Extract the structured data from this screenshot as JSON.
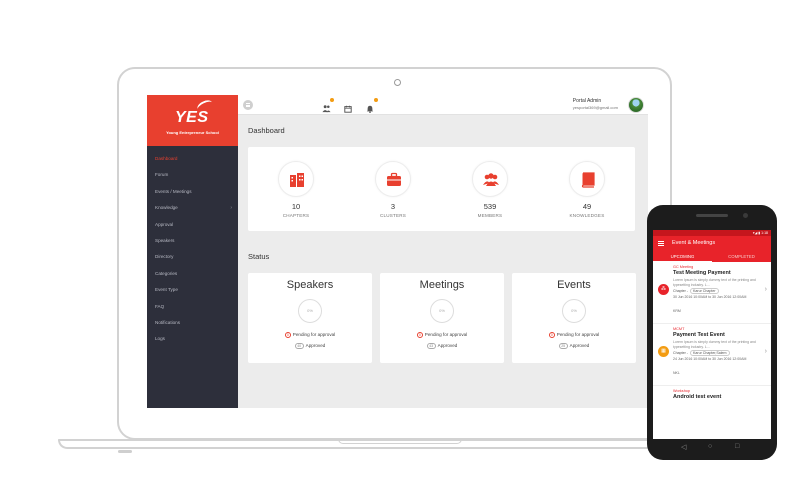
{
  "sidebar": {
    "logo": {
      "text": "YES",
      "tagline": "Young Entrepreneur School"
    },
    "items": [
      {
        "label": "Dashboard",
        "active": true
      },
      {
        "label": "Forum"
      },
      {
        "label": "Events / Meetings"
      },
      {
        "label": "Knowledge",
        "has_submenu": true,
        "caret": "›"
      },
      {
        "label": "Approval"
      },
      {
        "label": "Speakers"
      },
      {
        "label": "Directory"
      },
      {
        "label": "Categories"
      },
      {
        "label": "Event Type"
      },
      {
        "label": "FAQ"
      },
      {
        "label": "Notifications"
      },
      {
        "label": "Logs"
      }
    ]
  },
  "topbar": {
    "icons": [
      "users-icon",
      "calendar-icon",
      "bell-icon"
    ],
    "user": {
      "name": "Portal Admin",
      "email": "yesportal369@gmail.com"
    }
  },
  "dashboard": {
    "title": "Dashboard",
    "stats": [
      {
        "value": "10",
        "label": "CHAPTERS",
        "icon": "building-icon"
      },
      {
        "value": "3",
        "label": "CLUSTERS",
        "icon": "briefcase-icon"
      },
      {
        "value": "539",
        "label": "MEMBERS",
        "icon": "members-icon"
      },
      {
        "value": "49",
        "label": "KNOWLEDGES",
        "icon": "book-icon"
      }
    ]
  },
  "status": {
    "title": "Status",
    "cards": [
      {
        "title": "Speakers",
        "ring": "0%",
        "pending_count": "0",
        "pending_label": "Pending for approval",
        "approved_count": "40",
        "approved_label": "Approved"
      },
      {
        "title": "Meetings",
        "ring": "0%",
        "pending_count": "0",
        "pending_label": "Pending for approval",
        "approved_count": "43",
        "approved_label": "Approved"
      },
      {
        "title": "Events",
        "ring": "0%",
        "pending_count": "0",
        "pending_label": "Pending for approval",
        "approved_count": "25",
        "approved_label": "Approved"
      }
    ]
  },
  "phone": {
    "status_time": "▾◢ ▮ 1:18",
    "app_title": "Event & Meetings",
    "tabs": [
      "UPCOMING",
      "COMPLETED"
    ],
    "events": [
      {
        "category": "GC Meeting",
        "name": "Test Meeting Payment",
        "description": "Lorem Ipsum is simply dummy text of the printing and typesetting industry. L...",
        "chapter_label": "Chapter -",
        "chapter": "Karur Chapter",
        "dates": "30 Jun 2016 10:00AM to 30 Jun 2016 12:00AM",
        "location": "KRM",
        "icon_color": "#e8232a"
      },
      {
        "category": "MCMT",
        "name": "Payment Test Event",
        "description": "Lorem Ipsum is simply dummy text of the printing and typesetting industry. L...",
        "chapter_label": "Chapter -",
        "chapter": "Karur Chapter,Salem",
        "dates": "24 Jun 2016 10:00AM to 30 Jun 2016 12:00AM",
        "location": "NKL",
        "icon_color": "#f39c12"
      },
      {
        "category": "Workshop",
        "name": "Android test event",
        "icon_color": "#e8232a"
      }
    ],
    "nav": [
      "◁",
      "○",
      "□"
    ]
  }
}
